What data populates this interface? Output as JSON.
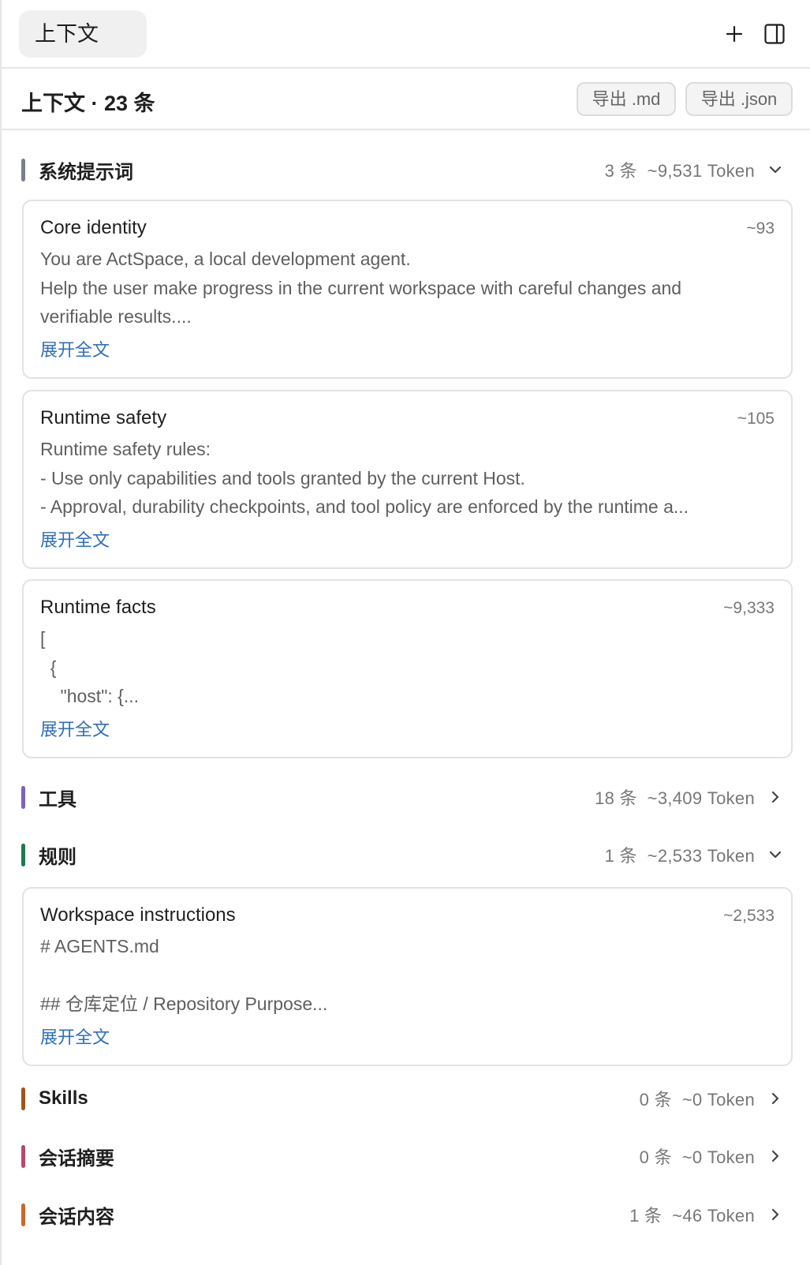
{
  "topbar": {
    "tab_label": "上下文",
    "add_icon": "plus-icon",
    "panel_icon": "sidebar-toggle-icon"
  },
  "header": {
    "title": "上下文 · 23 条",
    "export_md": "导出 .md",
    "export_json": "导出 .json"
  },
  "expand_label": "展开全文",
  "colors": {
    "system": "#7a7f8a",
    "tools": "#7b63b8",
    "rules": "#1d7a4e",
    "skills": "#a0561b",
    "summary": "#b8486f",
    "content": "#c8692c",
    "link": "#2f6fb8"
  },
  "sections": [
    {
      "key": "system",
      "title": "系统提示词",
      "meta": "3 条  ~9,531 Token",
      "expanded": true,
      "cards": [
        {
          "title": "Core identity",
          "count": "~93",
          "lines": [
            "You are ActSpace, a local development agent.",
            "Help the user make progress in the current workspace with careful changes and",
            "verifiable results...."
          ]
        },
        {
          "title": "Runtime safety",
          "count": "~105",
          "lines": [
            "Runtime safety rules:",
            "- Use only capabilities and tools granted by the current Host.",
            "- Approval, durability checkpoints, and tool policy are enforced by the runtime a..."
          ]
        },
        {
          "title": "Runtime facts",
          "count": "~9,333",
          "lines": [
            "[",
            "  {",
            "    \"host\": {..."
          ]
        }
      ]
    },
    {
      "key": "tools",
      "title": "工具",
      "meta": "18 条  ~3,409 Token",
      "expanded": false
    },
    {
      "key": "rules",
      "title": "规则",
      "meta": "1 条  ~2,533 Token",
      "expanded": true,
      "cards": [
        {
          "title": "Workspace instructions",
          "count": "~2,533",
          "lines": [
            "# AGENTS.md",
            "",
            "## 仓库定位 / Repository Purpose..."
          ]
        }
      ]
    },
    {
      "key": "skills",
      "title": "Skills",
      "meta": "0 条  ~0 Token",
      "expanded": false
    },
    {
      "key": "summary",
      "title": "会话摘要",
      "meta": "0 条  ~0 Token",
      "expanded": false
    },
    {
      "key": "content",
      "title": "会话内容",
      "meta": "1 条  ~46 Token",
      "expanded": false
    }
  ]
}
